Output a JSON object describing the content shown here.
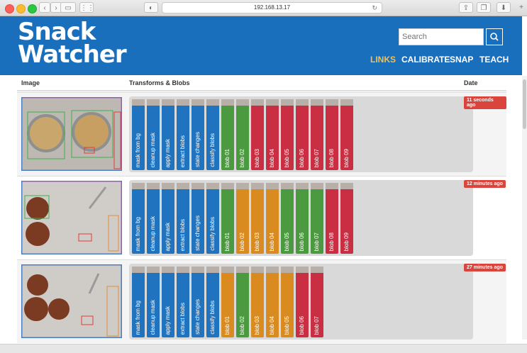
{
  "browser": {
    "url": "192.168.13.17"
  },
  "header": {
    "logo_line1": "Snack",
    "logo_line2": "Watcher",
    "search_placeholder": "Search",
    "nav": [
      "LINKS",
      "CALIBRATE",
      "SNAP",
      "TEACH"
    ],
    "active_nav": "LINKS",
    "brand_color": "#1a6fbd",
    "active_color": "#f2c14e"
  },
  "table": {
    "headers": {
      "image": "Image",
      "transforms": "Transforms & Blobs",
      "date": "Date"
    },
    "rows": [
      {
        "date": "11 seconds ago",
        "items": [
          {
            "label": "mask from bg",
            "color": "blue"
          },
          {
            "label": "cleanup mask",
            "color": "blue"
          },
          {
            "label": "apply mask",
            "color": "blue"
          },
          {
            "label": "extract blobs",
            "color": "blue"
          },
          {
            "label": "state changes",
            "color": "blue"
          },
          {
            "label": "classify blobs",
            "color": "blue"
          },
          {
            "label": "blob 01",
            "color": "green"
          },
          {
            "label": "blob 02",
            "color": "green"
          },
          {
            "label": "blob 03",
            "color": "red"
          },
          {
            "label": "blob 04",
            "color": "red"
          },
          {
            "label": "blob 05",
            "color": "red"
          },
          {
            "label": "blob 06",
            "color": "red"
          },
          {
            "label": "blob 07",
            "color": "red"
          },
          {
            "label": "blob 08",
            "color": "red"
          },
          {
            "label": "blob 09",
            "color": "red"
          }
        ]
      },
      {
        "date": "12 minutes ago",
        "items": [
          {
            "label": "mask from bg",
            "color": "blue"
          },
          {
            "label": "cleanup mask",
            "color": "blue"
          },
          {
            "label": "apply mask",
            "color": "blue"
          },
          {
            "label": "extract blobs",
            "color": "blue"
          },
          {
            "label": "state changes",
            "color": "blue"
          },
          {
            "label": "classify blobs",
            "color": "blue"
          },
          {
            "label": "blob 01",
            "color": "green"
          },
          {
            "label": "blob 02",
            "color": "orange"
          },
          {
            "label": "blob 03",
            "color": "orange"
          },
          {
            "label": "blob 04",
            "color": "orange"
          },
          {
            "label": "blob 05",
            "color": "green"
          },
          {
            "label": "blob 06",
            "color": "green"
          },
          {
            "label": "blob 07",
            "color": "green"
          },
          {
            "label": "blob 08",
            "color": "red"
          },
          {
            "label": "blob 09",
            "color": "red"
          }
        ]
      },
      {
        "date": "27 minutes ago",
        "items": [
          {
            "label": "mask from bg",
            "color": "blue"
          },
          {
            "label": "cleanup mask",
            "color": "blue"
          },
          {
            "label": "apply mask",
            "color": "blue"
          },
          {
            "label": "extract blobs",
            "color": "blue"
          },
          {
            "label": "state changes",
            "color": "blue"
          },
          {
            "label": "classify blobs",
            "color": "blue"
          },
          {
            "label": "blob 01",
            "color": "orange"
          },
          {
            "label": "blob 02",
            "color": "green"
          },
          {
            "label": "blob 03",
            "color": "orange"
          },
          {
            "label": "blob 04",
            "color": "orange"
          },
          {
            "label": "blob 05",
            "color": "orange"
          },
          {
            "label": "blob 06",
            "color": "red"
          },
          {
            "label": "blob 07",
            "color": "red"
          }
        ]
      }
    ]
  },
  "status_colors": {
    "blue": "#2073bf",
    "green": "#4c9a3f",
    "red": "#c92e42",
    "orange": "#d98b1f",
    "badge": "#d9443d"
  }
}
